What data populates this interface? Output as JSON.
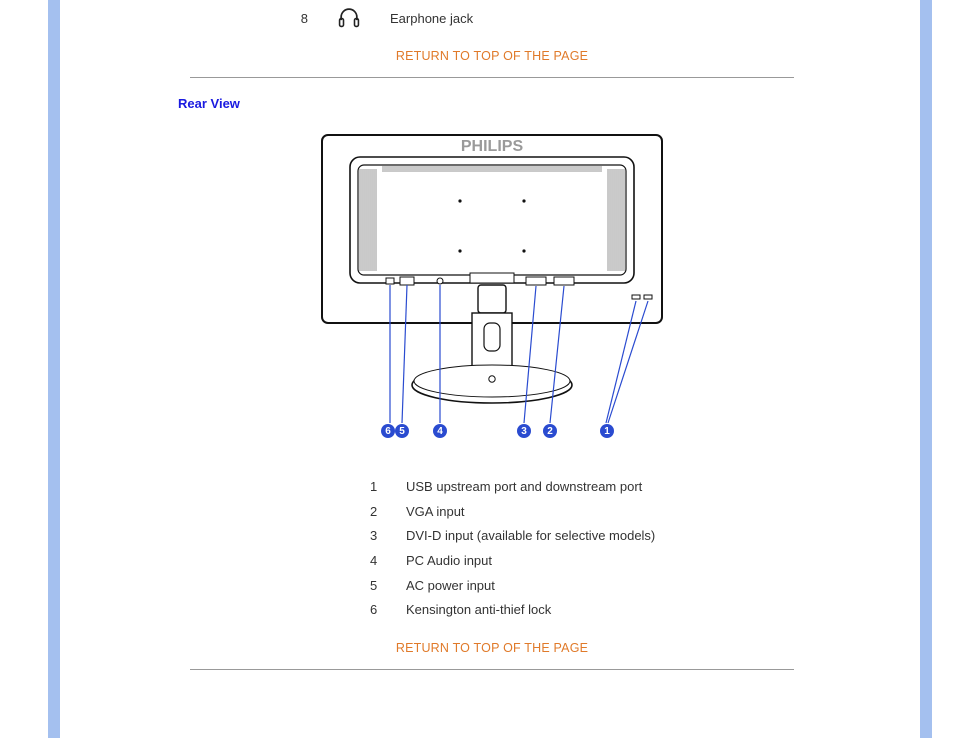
{
  "top_row": {
    "number": "8",
    "label": "Earphone jack"
  },
  "return_link": "RETURN TO TOP OF THE PAGE",
  "section_title": "Rear View",
  "brand": "PHILIPS",
  "callouts": [
    "6",
    "5",
    "4",
    "3",
    "2",
    "1"
  ],
  "legend": [
    {
      "n": "1",
      "text": "USB upstream port and downstream port"
    },
    {
      "n": "2",
      "text": "VGA input"
    },
    {
      "n": "3",
      "text": "DVI-D input (available for selective models)"
    },
    {
      "n": "4",
      "text": "PC Audio input"
    },
    {
      "n": "5",
      "text": "AC power input"
    },
    {
      "n": "6",
      "text": "Kensington anti-thief lock"
    }
  ]
}
